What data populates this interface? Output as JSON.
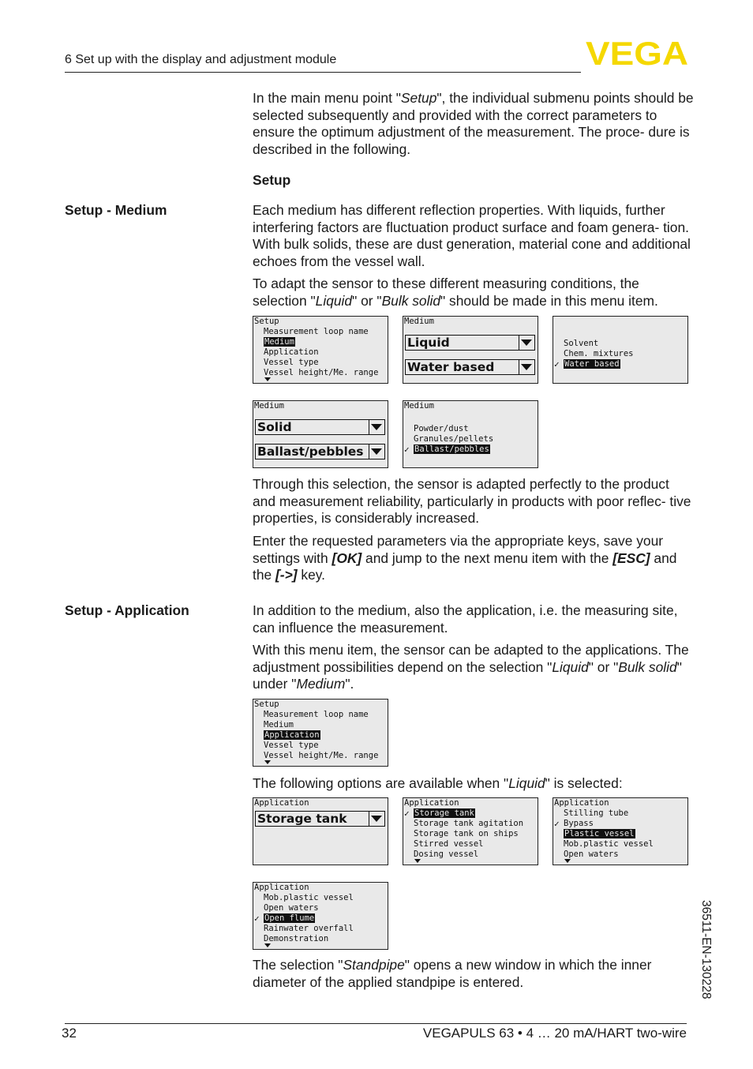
{
  "header": {
    "title": "6 Set up with the display and adjustment module",
    "logo_text": "VEGA",
    "logo_color": "#f5d800"
  },
  "intro": {
    "p1_a": "In the main menu point \"",
    "p1_b": "Setup",
    "p1_c": "\", the individual submenu points should be selected subsequently and provided with the correct parameters to ensure the optimum adjustment of the measurement. The proce- dure is described in the following.",
    "heading": "Setup"
  },
  "medium_section": {
    "label": "Setup - Medium",
    "p1": "Each medium has different reflection properties. With liquids, further interfering factors are fluctuation product surface and foam genera- tion. With bulk solids, these are dust generation, material cone and additional echoes from the vessel wall.",
    "p2_a": "To adapt the sensor to these different measuring conditions, the selection \"",
    "p2_b": "Liquid",
    "p2_c": "\" or \"",
    "p2_d": "Bulk solid",
    "p2_e": "\" should be made in this menu item.",
    "p3": "Through this selection, the sensor is adapted perfectly to the product and measurement reliability, particularly in products with poor reflec- tive properties, is considerably increased.",
    "p4_a": "Enter the requested parameters via the appropriate keys, save your settings with ",
    "p4_ok": "[OK]",
    "p4_b": " and jump to the next menu item with the ",
    "p4_esc": "[ESC]",
    "p4_c": " and the ",
    "p4_arrow": "[->]",
    "p4_d": " key."
  },
  "application_section": {
    "label": "Setup - Application",
    "p1": "In addition to the medium, also the application, i.e. the measuring site, can influence the measurement.",
    "p2_a": "With this menu item, the sensor can be adapted to the applications. The adjustment possibilities depend on the selection \"",
    "p2_b": "Liquid",
    "p2_c": "\" or \"",
    "p2_d": "Bulk solid",
    "p2_e": "\" under \"",
    "p2_f": "Medium",
    "p2_g": "\".",
    "p3_a": "The following options are available when \"",
    "p3_b": "Liquid",
    "p3_c": "\" is selected:",
    "p4_a": "The selection \"",
    "p4_b": "Standpipe",
    "p4_c": "\" opens a new window in which the inner diameter of the applied standpipe is entered."
  },
  "lcd": {
    "setup_medium": {
      "title": "Setup",
      "items": [
        "Measurement loop name",
        "Medium",
        "Application",
        "Vessel type",
        "Vessel height/Me. range"
      ],
      "selected": 1
    },
    "medium_liquid": {
      "title": "Medium",
      "field1": "Liquid",
      "field2": "Water based"
    },
    "medium_liquid_list": {
      "title": "",
      "items": [
        "Solvent",
        "Chem. mixtures",
        "Water based"
      ],
      "selected": 2,
      "checked": 2
    },
    "medium_solid": {
      "title": "Medium",
      "field1": "Solid",
      "field2": "Ballast/pebbles"
    },
    "medium_solid_list": {
      "title": "Medium",
      "items": [
        "Powder/dust",
        "Granules/pellets",
        "Ballast/pebbles"
      ],
      "selected": 2,
      "checked": 2
    },
    "setup_application": {
      "title": "Setup",
      "items": [
        "Measurement loop name",
        "Medium",
        "Application",
        "Vessel type",
        "Vessel height/Me. range"
      ],
      "selected": 2
    },
    "app_field": {
      "title": "Application",
      "field1": "Storage tank"
    },
    "app_list1": {
      "title": "Application",
      "items": [
        "Storage tank",
        "Storage tank agitation",
        "Storage tank on ships",
        "Stirred vessel",
        "Dosing vessel"
      ],
      "selected": 0,
      "checked": 0
    },
    "app_list2": {
      "title": "Application",
      "items": [
        "Stilling tube",
        "Bypass",
        "Plastic vessel",
        "Mob.plastic vessel",
        "Open waters"
      ],
      "selected": 2,
      "checked": 1
    },
    "app_list3": {
      "title": "Application",
      "items": [
        "Mob.plastic vessel",
        "Open waters",
        "Open flume",
        "Rainwater overfall",
        "Demonstration"
      ],
      "selected": 2,
      "checked": 2
    }
  },
  "side_doc_id": "36511-EN-130228",
  "footer": {
    "page": "32",
    "product": "VEGAPULS 63 • 4 … 20 mA/HART two-wire"
  }
}
